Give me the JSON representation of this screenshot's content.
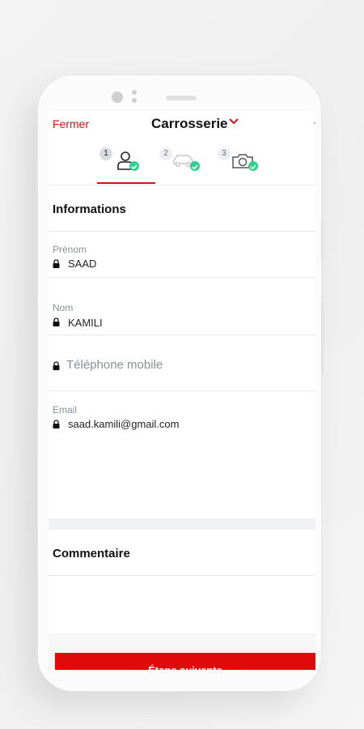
{
  "header": {
    "close_label": "Fermer",
    "title": "Carrosserie"
  },
  "steps": [
    {
      "number": "1",
      "icon": "person-icon",
      "status": "completed",
      "active": true
    },
    {
      "number": "2",
      "icon": "car-icon",
      "status": "completed",
      "active": false
    },
    {
      "number": "3",
      "icon": "camera-icon",
      "status": "completed",
      "active": false
    }
  ],
  "informations": {
    "title": "Informations",
    "firstname": {
      "label": "Prénom",
      "value": "SAAD"
    },
    "lastname": {
      "label": "Nom",
      "value": "KAMILI"
    },
    "phone": {
      "placeholder": "Téléphone mobile"
    },
    "email": {
      "label": "Email",
      "value": "saad.kamili@gmail.com"
    }
  },
  "comment": {
    "title": "Commentaire"
  },
  "footer": {
    "next_label": "Étape suivante"
  },
  "colors": {
    "accent": "#d31216",
    "button": "#e10a0a",
    "check": "#2fd18b"
  }
}
